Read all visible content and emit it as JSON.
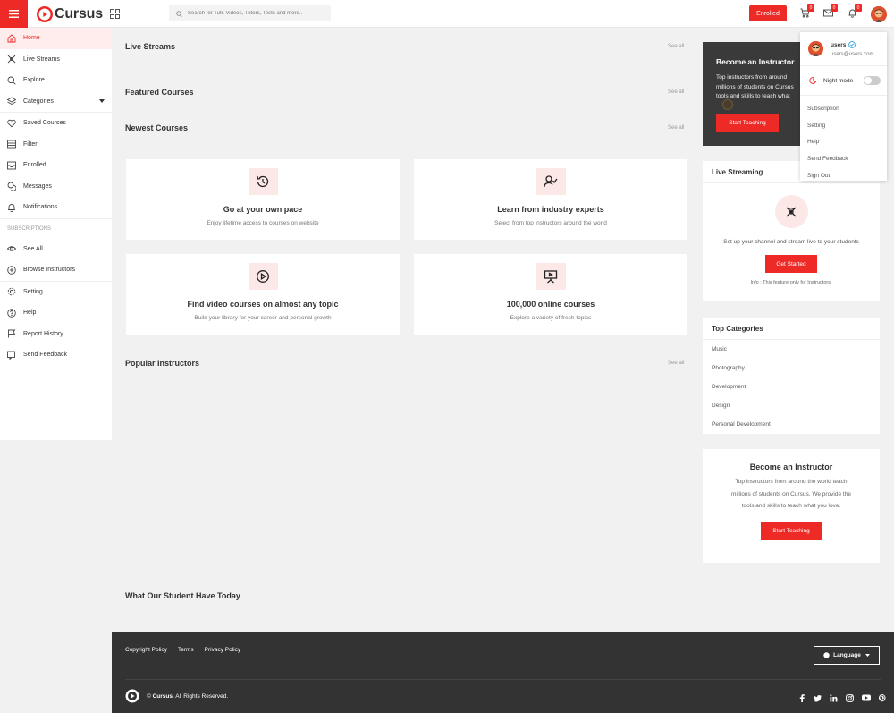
{
  "header": {
    "logo_text": "Cursus",
    "search_placeholder": "Search for Tuts Videos, Tutors, Tests and more..",
    "enrolled_label": "Enrolled",
    "cart_badge": "0",
    "messages_badge": "0",
    "notifications_badge": "0"
  },
  "sidebar": {
    "items": [
      {
        "label": "Home",
        "icon": "home-icon"
      },
      {
        "label": "Live Streams",
        "icon": "broadcast-icon"
      },
      {
        "label": "Explore",
        "icon": "search-icon"
      },
      {
        "label": "Categories",
        "icon": "layers-icon"
      },
      {
        "label": "Saved Courses",
        "icon": "heart-icon"
      },
      {
        "label": "Filter",
        "icon": "filter-icon"
      },
      {
        "label": "Enrolled",
        "icon": "inbox-icon"
      },
      {
        "label": "Messages",
        "icon": "chat-icon"
      },
      {
        "label": "Notifications",
        "icon": "bell-icon"
      }
    ],
    "subscriptions_heading": "SUBSCRIPTIONS",
    "sub_items": [
      {
        "label": "See All",
        "icon": "eye-icon"
      },
      {
        "label": "Browse Instructors",
        "icon": "plus-circle-icon"
      }
    ],
    "bottom_items": [
      {
        "label": "Setting",
        "icon": "gear-icon"
      },
      {
        "label": "Help",
        "icon": "help-icon"
      },
      {
        "label": "Report History",
        "icon": "flag-icon"
      },
      {
        "label": "Send Feedback",
        "icon": "feedback-icon"
      }
    ]
  },
  "main": {
    "live_streams_title": "Live Streams",
    "featured_title": "Featured Courses",
    "newest_title": "Newest Courses",
    "popular_instructors_title": "Popular Instructors",
    "students_title": "What Our Student Have Today",
    "see_all": "See all",
    "features": [
      {
        "title": "Go at your own pace",
        "desc": "Enjoy lifetime access to courses on website",
        "icon": "history-icon"
      },
      {
        "title": "Learn from industry experts",
        "desc": "Select from top instructors around the world",
        "icon": "user-check-icon"
      },
      {
        "title": "Find video courses on almost any topic",
        "desc": "Build your library for your career and personal growth",
        "icon": "play-circle-icon"
      },
      {
        "title": "100,000 online courses",
        "desc": "Explore a variety of fresh topics",
        "icon": "presentation-icon"
      }
    ]
  },
  "promo": {
    "title": "Become an Instructor",
    "desc_line1": "Top instructors from around",
    "desc_line2": "millions of students on Cursus",
    "desc_line3": "tools and skills to teach what",
    "button": "Start Teaching"
  },
  "live_streaming": {
    "title": "Live Streaming",
    "text": "Set up your channel and stream live to your students",
    "button": "Get Started",
    "info": "Info : This feature only for Instructors."
  },
  "top_categories": {
    "title": "Top Categories",
    "items": [
      "Music",
      "Photography",
      "Development",
      "Design",
      "Personal Development"
    ]
  },
  "become_instructor": {
    "title": "Become an Instructor",
    "desc_line1": "Top instructors from around the world teach",
    "desc_line2": "millions of students on Cursus. We provide the",
    "desc_line3": "tools and skills to teach what you love.",
    "button": "Start Teaching"
  },
  "dropdown": {
    "name": "users",
    "email": "users@users.com",
    "night_mode": "Night mode",
    "night_mode_on": false,
    "items": [
      "Subscription",
      "Setting",
      "Help",
      "Send Feedback",
      "Sign Out"
    ]
  },
  "footer": {
    "links": [
      "Copyright Policy",
      "Terms",
      "Privacy Policy"
    ],
    "language": "Language",
    "brand": "Cursus",
    "copyright": ". All Rights Reserved.",
    "socials": [
      "facebook-icon",
      "twitter-icon",
      "linkedin-icon",
      "instagram-icon",
      "youtube-icon",
      "pinterest-icon"
    ]
  },
  "colors": {
    "accent": "#ed2a26",
    "accent_light": "#fce8e6",
    "footer_bg": "#333333",
    "page_bg": "#f1f1f1"
  }
}
